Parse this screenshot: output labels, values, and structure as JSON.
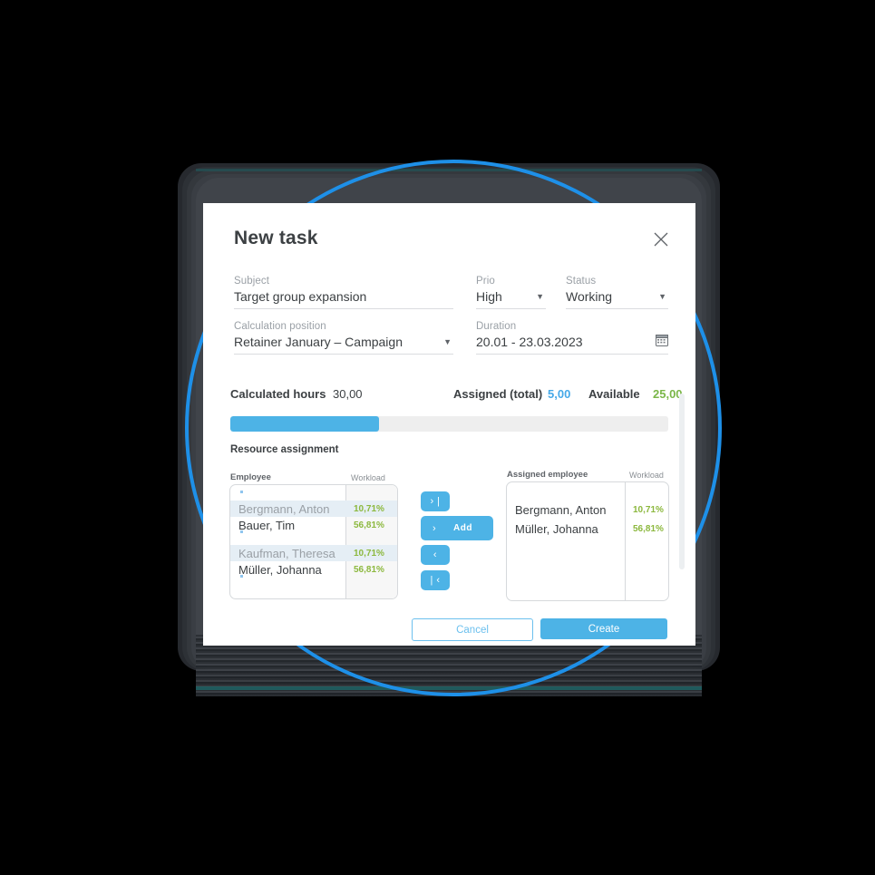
{
  "dialog": {
    "title": "New task",
    "close_icon": "close-icon",
    "fields": [
      {
        "label": "Subject",
        "value": "Target group expansion",
        "type": "text"
      },
      {
        "label": "Prio",
        "value": "High",
        "type": "select"
      },
      {
        "label": "Status",
        "value": "Working",
        "type": "select"
      },
      {
        "label": "Calculation position",
        "value": "Retainer January – Campaign",
        "type": "select"
      },
      {
        "label": "Duration",
        "value": "20.01 - 23.03.2023",
        "type": "date",
        "icon": "calendar-icon"
      }
    ],
    "summary": {
      "calculated_label": "Calculated hours",
      "calculated_value": "30,00",
      "assigned_label": "Assigned (total)",
      "assigned_value": "5,00",
      "available_label": "Available",
      "available_value": "25,00",
      "progress_percent": 34
    },
    "section_title": "Resource assignment",
    "left_list": {
      "header_name": "Employee",
      "header_workload": "Workload",
      "rows": [
        {
          "name": "Bergmann, Anton",
          "workload": "10,71%",
          "selected": true
        },
        {
          "name": "Bauer, Tim",
          "workload": "56,81%",
          "selected": false
        },
        {
          "name": "Kaufman, Theresa",
          "workload": "10,71%",
          "selected": true
        },
        {
          "name": "Müller, Johanna",
          "workload": "56,81%",
          "selected": false
        }
      ]
    },
    "right_list": {
      "header_name": "Assigned employee",
      "header_workload": "Workload",
      "rows": [
        {
          "name": "Bergmann, Anton",
          "workload": "10,71%"
        },
        {
          "name": "Müller, Johanna",
          "workload": "56,81%"
        }
      ]
    },
    "transfer_buttons": [
      {
        "name": "move-all-right",
        "glyph": "› |"
      },
      {
        "name": "add",
        "arrow": "›",
        "label": "Add"
      },
      {
        "name": "move-left",
        "glyph": "‹"
      },
      {
        "name": "move-all-left",
        "glyph": "| ‹"
      }
    ],
    "footer": {
      "cancel_label": "Cancel",
      "create_label": "Create"
    }
  },
  "colors": {
    "accent_blue": "#4db3e6",
    "circle_blue": "#1e90e8",
    "green": "#7ab648",
    "workload_green": "#8cb83e",
    "text": "#3c4043",
    "muted": "#9aa0a6"
  }
}
